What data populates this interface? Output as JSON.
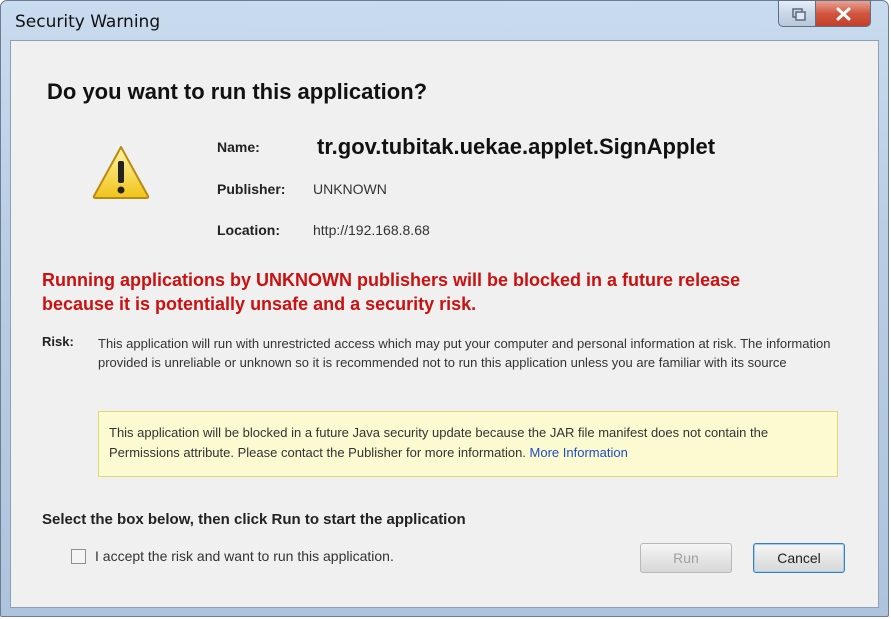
{
  "window": {
    "title": "Security Warning"
  },
  "dialog": {
    "heading": "Do you want to run this application?",
    "icon": "warning-icon",
    "name_label": "Name:",
    "name_value": "tr.gov.tubitak.uekae.applet.SignApplet",
    "publisher_label": "Publisher:",
    "publisher_value": "UNKNOWN",
    "location_label": "Location:",
    "location_value": "http://192.168.8.68",
    "warning_line1": "Running applications by UNKNOWN publishers will be blocked in a future release",
    "warning_line2": "because it is potentially unsafe and a security risk.",
    "risk_label": "Risk:",
    "risk_text": "This application will run with unrestricted access which may put your computer and personal information at risk. The information provided is unreliable or unknown so it is recommended not to run this application unless you are familiar with its source",
    "notice_text": "This application will be blocked in a future Java security update because the JAR file manifest does not contain the Permissions attribute. Please contact the Publisher for more information.",
    "notice_link": "More Information",
    "select_instruction": "Select the box below, then click Run to start the application",
    "accept_label": "I accept the risk and want to run this application.",
    "accept_checked": false,
    "run_label": "Run",
    "cancel_label": "Cancel"
  },
  "colors": {
    "warning_red": "#cc1010",
    "link_blue": "#1c4dc5",
    "notice_bg": "#fcfad0"
  }
}
